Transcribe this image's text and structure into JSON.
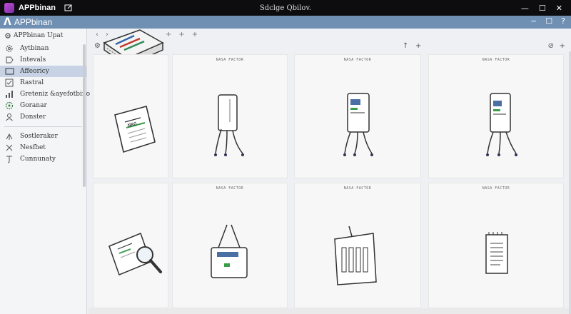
{
  "titlebar": {
    "app_name": "APPbinan",
    "window_title": "Sdclge Qbilov."
  },
  "appbar": {
    "name": "APPbinan"
  },
  "sidebar": {
    "header": "APPbinan Upat",
    "items": [
      {
        "label": "Aytbinan",
        "icon": "gear-icon",
        "active": false
      },
      {
        "label": "Intevals",
        "icon": "tag-icon",
        "active": false
      },
      {
        "label": "Affeoricy",
        "icon": "window-icon",
        "active": true
      },
      {
        "label": "Rastral",
        "icon": "check-icon",
        "active": false
      },
      {
        "label": "Greteniz &ayefotbino",
        "icon": "bar-chart-icon",
        "active": false
      },
      {
        "label": "Goranar",
        "icon": "settings-icon",
        "active": false
      },
      {
        "label": "Donster",
        "icon": "person-icon",
        "active": false
      }
    ],
    "items2": [
      {
        "label": "Sostleraker",
        "icon": "arrow-icon"
      },
      {
        "label": "Nesfhet",
        "icon": "cross-arrow-icon"
      },
      {
        "label": "Cunnunaty",
        "icon": "hook-icon"
      }
    ]
  },
  "grid": {
    "card_labels": [
      "NASA FACTOR",
      "NASA FACTOR",
      "NASA FACTOR",
      "NASA FACTOR",
      "NASA FACTOR",
      "NASA FACTOR",
      "NASA FACTOR"
    ],
    "doc_text": "NBO"
  }
}
